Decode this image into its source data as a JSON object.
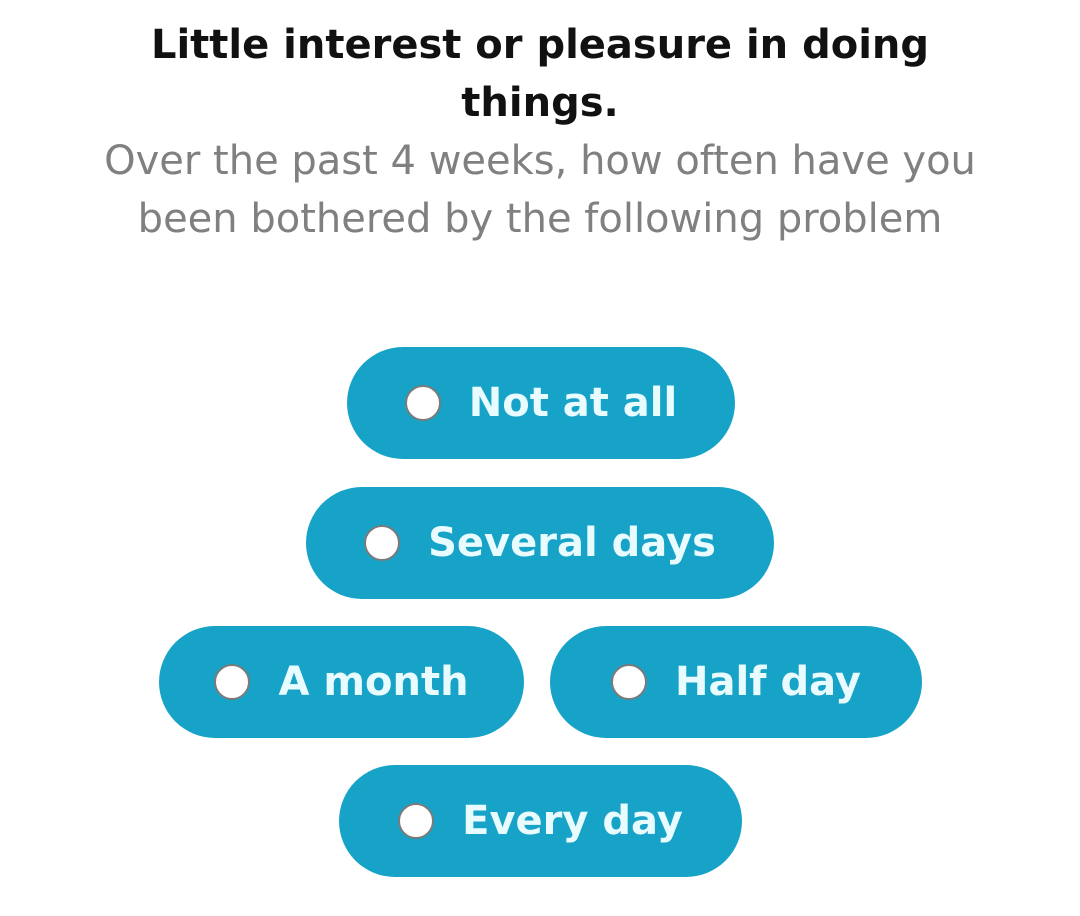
{
  "question": {
    "title": "Little interest or pleasure in doing things.",
    "subtitle": "Over the past 4 weeks, how often have you been bothered by the following problem"
  },
  "options": [
    {
      "label": "Not at all",
      "selected": false
    },
    {
      "label": "Several days",
      "selected": false
    },
    {
      "label": "A month",
      "selected": false
    },
    {
      "label": "Half day",
      "selected": false
    },
    {
      "label": "Every day",
      "selected": false
    }
  ],
  "colors": {
    "pill_background": "#17a3c8",
    "pill_text": "#e8fbff",
    "title_text": "#111111",
    "subtitle_text": "#808080",
    "radio_fill": "#ffffff",
    "radio_border": "#7a7a7a"
  }
}
